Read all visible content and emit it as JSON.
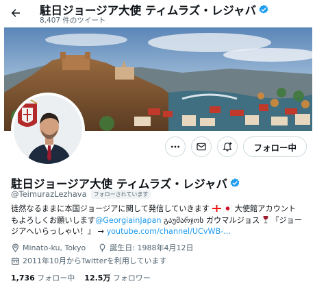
{
  "header": {
    "name": "駐日ジョージア大使 ティムラズ・レジャバ",
    "tweet_count": "8,407 件のツイート"
  },
  "actions": {
    "follow_label": "フォロー中"
  },
  "profile": {
    "name": "駐日ジョージア大使 ティムラズ・レジャバ",
    "handle": "@TeimurazLezhava",
    "follows_you": "フォローされています",
    "bio": {
      "line1": "徒然なるままに本国ジョージアに関して発信していきます",
      "line1b": " 大使館アカウント",
      "line2a": "もよろしくお願いします",
      "line2_mention": "@GeorgiainJapan",
      "line2b": " გაუმარჯოს ガウマルジョス",
      "line2c": " 『ジョー",
      "line3a": "ジアへいらっしゃい！』 → ",
      "line3_link": "youtube.com/channel/UCvWB-..."
    },
    "location": "Minato-ku, Tokyo",
    "birthday": "誕生日: 1988年4月12日",
    "joined": "2011年10月からTwitterを利用しています",
    "following_count": "1,736",
    "following_label": "フォロー中",
    "followers_count": "12.5万",
    "followers_label": "フォロワー"
  },
  "colors": {
    "accent": "#1d9bf0",
    "text": "#0f1419",
    "muted": "#536471"
  }
}
